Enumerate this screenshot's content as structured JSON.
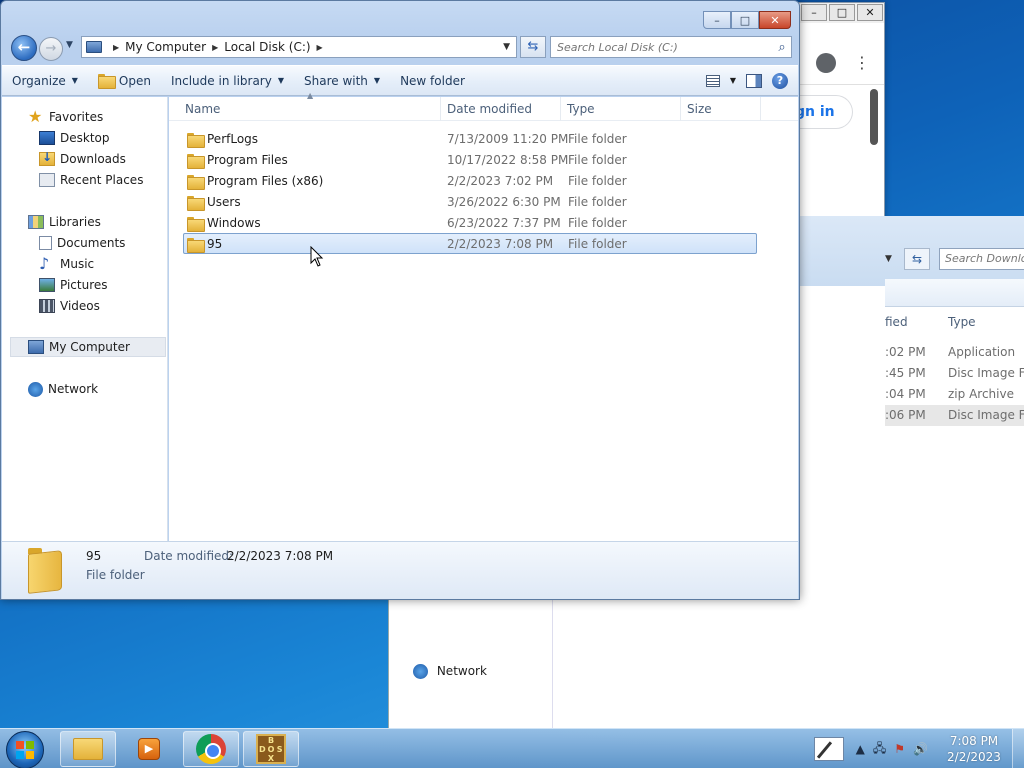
{
  "explorer": {
    "breadcrumb": [
      "My Computer",
      "Local Disk (C:)"
    ],
    "search_placeholder": "Search Local Disk (C:)",
    "caption": {
      "minimize": "–",
      "maximize": "□",
      "close": "✕"
    },
    "commands": {
      "organize": "Organize",
      "open": "Open",
      "include_in_library": "Include in library",
      "share_with": "Share with",
      "new_folder": "New folder",
      "help": "?"
    },
    "sidebar": {
      "favorites": "Favorites",
      "desktop": "Desktop",
      "downloads": "Downloads",
      "recent_places": "Recent Places",
      "libraries": "Libraries",
      "documents": "Documents",
      "music": "Music",
      "pictures": "Pictures",
      "videos": "Videos",
      "my_computer": "My Computer",
      "network": "Network"
    },
    "columns": {
      "name": "Name",
      "date_modified": "Date modified",
      "type": "Type",
      "size": "Size"
    },
    "files": [
      {
        "name": "PerfLogs",
        "date": "7/13/2009 11:20 PM",
        "type": "File folder"
      },
      {
        "name": "Program Files",
        "date": "10/17/2022 8:58 PM",
        "type": "File folder"
      },
      {
        "name": "Program Files (x86)",
        "date": "2/2/2023 7:02 PM",
        "type": "File folder"
      },
      {
        "name": "Users",
        "date": "3/26/2022 6:30 PM",
        "type": "File folder"
      },
      {
        "name": "Windows",
        "date": "6/23/2022 7:37 PM",
        "type": "File folder"
      },
      {
        "name": "95",
        "date": "2/2/2023 7:08 PM",
        "type": "File folder"
      }
    ],
    "details": {
      "name": "95",
      "modified_label": "Date modified:",
      "modified_value": "2/2/2023 7:08 PM",
      "type": "File folder"
    }
  },
  "background_browser": {
    "sign_in": "gn in",
    "minimize": "–",
    "maximize": "□",
    "close": "✕"
  },
  "background_explorer": {
    "search_text": "Search Downlo",
    "col_modified_partial": "fied",
    "col_type": "Type",
    "rows": [
      {
        "time": ":02 PM",
        "type": "Application"
      },
      {
        "time": ":45 PM",
        "type": "Disc Image Fil"
      },
      {
        "time": ":04 PM",
        "type": "zip Archive"
      },
      {
        "time": ":06 PM",
        "type": "Disc Image Fil"
      }
    ],
    "network": "Network"
  },
  "taskbar": {
    "clock_time": "7:08 PM",
    "clock_date": "2/2/2023",
    "dos_label": [
      "B",
      "O",
      "D",
      "O",
      "S",
      "X"
    ]
  }
}
